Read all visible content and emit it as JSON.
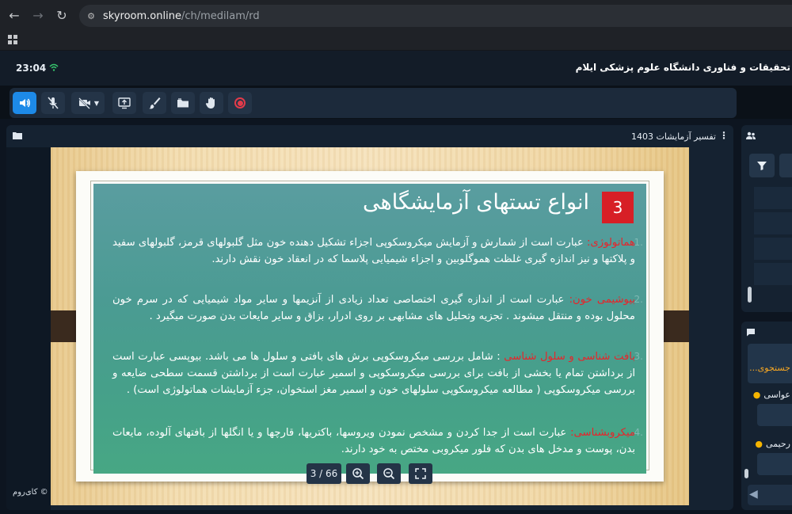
{
  "browser": {
    "url_host": "skyroom.online",
    "url_path": "/ch/medilam/rd"
  },
  "header": {
    "clock": "23:04",
    "org_title": "تحقیقات و فناوری دانشگاه علوم پزشکی ایلام"
  },
  "toolbar": {
    "tools": [
      "speaker-icon",
      "mic-muted-icon",
      "camera-off-icon",
      "screen-share-icon",
      "brush-icon",
      "folder-icon",
      "raise-hand-icon",
      "record-icon"
    ]
  },
  "presentation": {
    "title": "تفسیر آزمایشات 1403",
    "footer_label": "© کای‌روم",
    "page_indicator": "3 / 66"
  },
  "slide": {
    "number": "3",
    "heading": "انواع تستهای آزمایشگاهی",
    "bullets": [
      {
        "num": "1.",
        "term": "هماتولوژی:",
        "text": " عبارت است از شمارش و آزمایش میکروسکوپی اجزاء تشکیل دهنده خون مثل گلبولهای قرمز، گلبولهای سفید و پلاکتها و نیز اندازه گیری غلظت هموگلوبین و اجزاء شیمیایی پلاسما که در انعقاد خون نقش دارند."
      },
      {
        "num": "2.",
        "term": "بیوشیمی خون:",
        "text": " عبارت است از اندازه گیری اختصاصی تعداد زیادی از آنزیمها و سایر مواد شیمیایی که در سرم خون محلول بوده و منتقل میشوند . تجزیه وتحلیل های مشابهی بر روی ادرار، بزاق و سایر مایعات بدن صورت میگیرد ."
      },
      {
        "num": "3.",
        "term": "بافت شناسی و سلول شناسی",
        "text": " : شامل بررسی میکروسکوپی برش های بافتی و سلول ها می باشد. بیوپسی عبارت است از برداشتن تمام یا بخشی از بافت برای بررسی میکروسکوپی و اسمیر عبارت است از برداشتن قسمت سطحی ضایعه و بررسی میکروسکوپی ( مطالعه میکروسکوپی سلولهای خون و اسمیر مغز استخوان، جزء آزمایشات هماتولوژی است) ."
      },
      {
        "num": "4.",
        "term": "میکروبشناسی:",
        "text": " عبارت است از جدا کردن و مشخص نمودن ویروسها، باکتریها، قارچها و یا انگلها از بافتهای آلوده، مایعات بدن، پوست و مدخل های بدن که فلور میکروبی مختص به خود دارند."
      }
    ]
  },
  "chat": {
    "search_placeholder": "جستجوی...",
    "messages": [
      {
        "name": "عواسی"
      },
      {
        "name": "رحیمی"
      }
    ]
  }
}
